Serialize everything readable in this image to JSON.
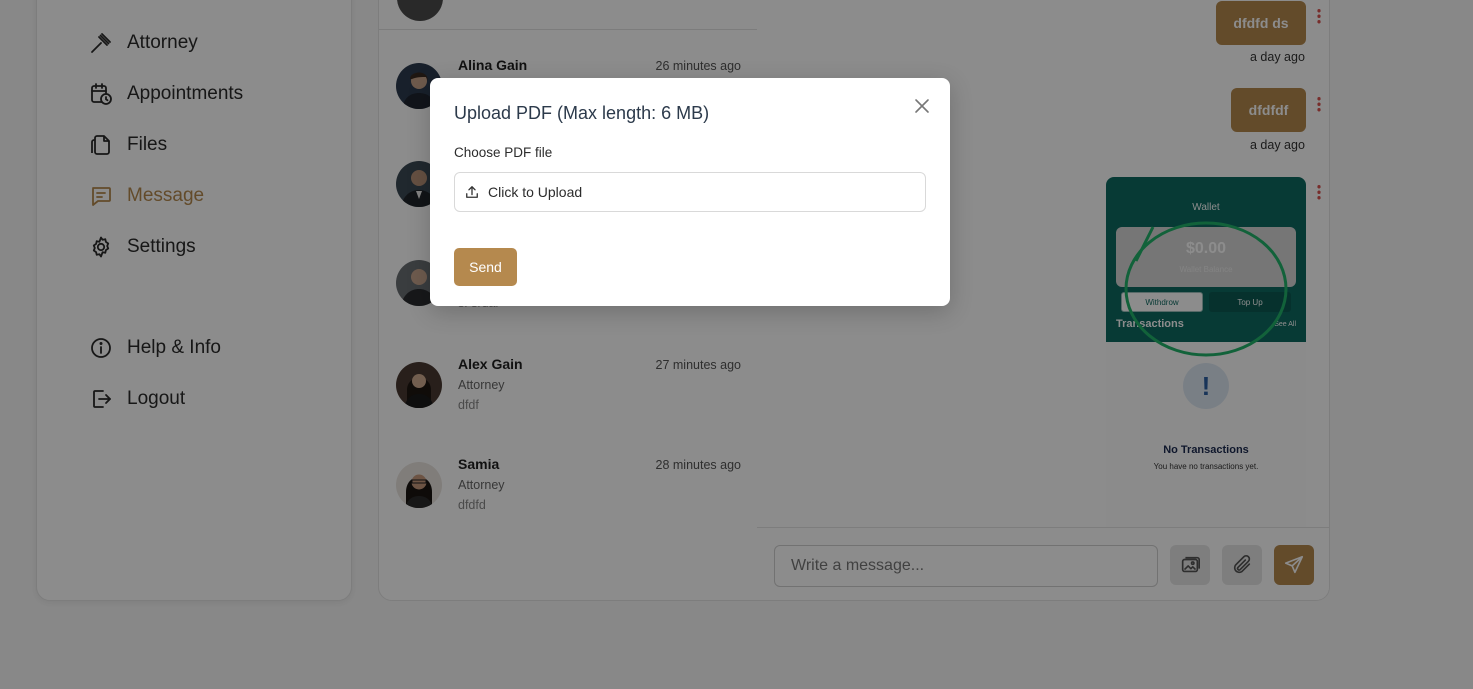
{
  "sidebar": {
    "items": [
      {
        "label": "Attorney",
        "icon": "gavel-icon"
      },
      {
        "label": "Appointments",
        "icon": "calendar-clock-icon"
      },
      {
        "label": "Files",
        "icon": "files-icon"
      },
      {
        "label": "Message",
        "icon": "message-icon",
        "active": true
      },
      {
        "label": "Settings",
        "icon": "gear-icon"
      },
      {
        "label": "Help & Info",
        "icon": "info-icon"
      },
      {
        "label": "Logout",
        "icon": "logout-icon"
      }
    ]
  },
  "conversations": [
    {
      "name": "Alina Gain",
      "time": "26 minutes ago",
      "role": "",
      "last": ""
    },
    {
      "name": "",
      "time": "",
      "role": "",
      "last": ""
    },
    {
      "name": "",
      "time": "",
      "role": "",
      "last": "sf srdar"
    },
    {
      "name": "Alex Gain",
      "time": "27 minutes ago",
      "role": "Attorney",
      "last": "dfdf"
    },
    {
      "name": "Samia",
      "time": "28 minutes ago",
      "role": "Attorney",
      "last": "dfdfd"
    }
  ],
  "chat": {
    "messages": [
      {
        "text": "dfdfd ds",
        "time": "a day ago"
      },
      {
        "text": "dfdfdf",
        "time": "a day ago"
      }
    ],
    "screenshot": {
      "title": "Wallet",
      "amount": "$0.00",
      "balance_label": "Wallet Balance",
      "withdraw": "Withdrow",
      "topup": "Top Up",
      "transactions": "Transactions",
      "see_all": "See All",
      "empty_title": "No Transactions",
      "empty_sub": "You have no transactions yet."
    },
    "composer": {
      "placeholder": "Write a message..."
    }
  },
  "modal": {
    "title": "Upload PDF (Max length: 6 MB)",
    "field_label": "Choose PDF file",
    "upload_label": "Click to Upload",
    "send_label": "Send"
  },
  "colors": {
    "accent": "#b5894e",
    "danger": "#d9534f",
    "teal": "#0e6a62"
  }
}
